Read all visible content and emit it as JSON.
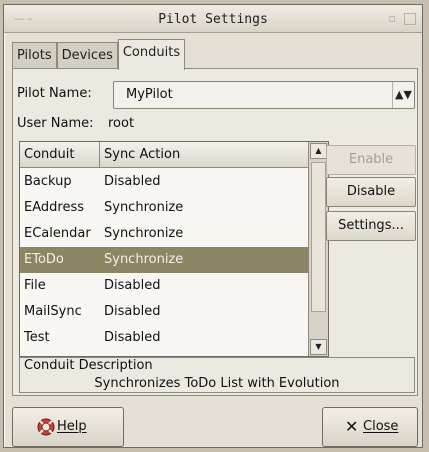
{
  "window": {
    "title": "Pilot Settings"
  },
  "tabs": [
    {
      "label": "Pilots",
      "active": false
    },
    {
      "label": "Devices",
      "active": false
    },
    {
      "label": "Conduits",
      "active": true
    }
  ],
  "pilot": {
    "label": "Pilot Name:",
    "value": "MyPilot"
  },
  "user": {
    "label": "User Name:",
    "value": "root"
  },
  "table": {
    "headers": [
      "Conduit",
      "Sync Action"
    ],
    "rows": [
      {
        "conduit": "Backup",
        "action": "Disabled"
      },
      {
        "conduit": "EAddress",
        "action": "Synchronize"
      },
      {
        "conduit": "ECalendar",
        "action": "Synchronize"
      },
      {
        "conduit": "EToDo",
        "action": "Synchronize",
        "selected": true
      },
      {
        "conduit": "File",
        "action": "Disabled"
      },
      {
        "conduit": "MailSync",
        "action": "Disabled"
      },
      {
        "conduit": "Test",
        "action": "Disabled"
      }
    ]
  },
  "actions": {
    "enable": "Enable",
    "disable": "Disable",
    "settings": "Settings..."
  },
  "description": {
    "title": "Conduit Description",
    "text": "Synchronizes ToDo List with Evolution"
  },
  "buttons": {
    "help": "Help",
    "close": "Close"
  },
  "colors": {
    "selection": "#8d8665",
    "window_bg": "#e4e0d6"
  }
}
